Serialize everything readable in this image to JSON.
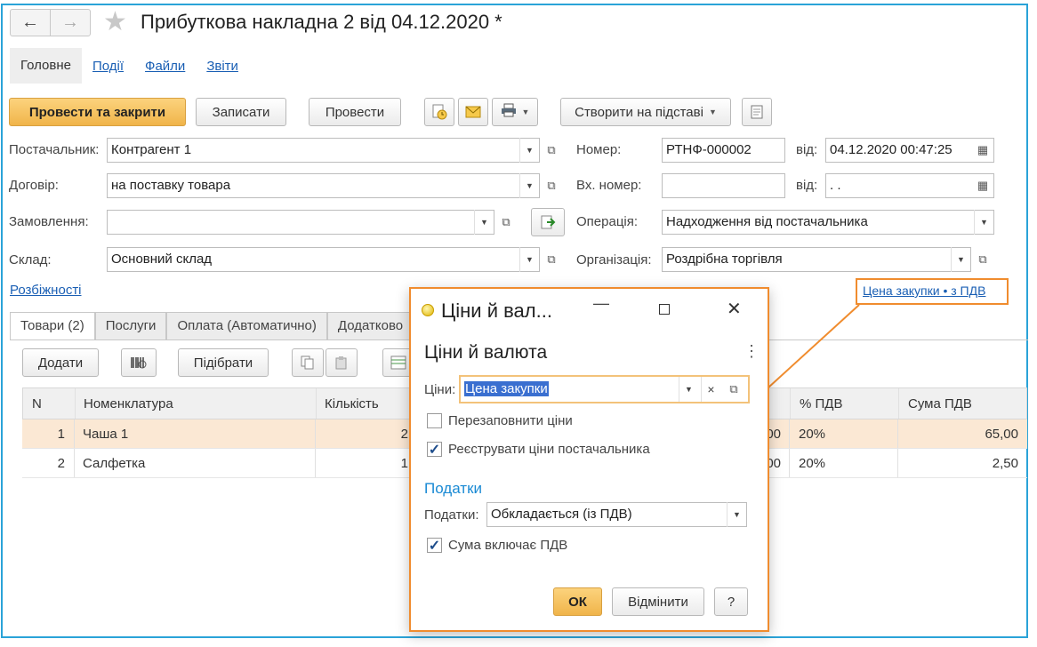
{
  "window": {
    "title": "Прибуткова накладна 2 від 04.12.2020 *",
    "back_glyph": "🡐",
    "forward_glyph": "🡒"
  },
  "top_tabs": [
    {
      "label": "Головне"
    },
    {
      "label": "Події"
    },
    {
      "label": "Файли"
    },
    {
      "label": "Звіти"
    }
  ],
  "toolbar": {
    "post_close": "Провести та закрити",
    "save": "Записати",
    "post": "Провести",
    "create_based": "Створити на підставі"
  },
  "form": {
    "supplier_label": "Постачальник:",
    "supplier_value": "Контрагент 1",
    "contract_label": "Договір:",
    "contract_value": "на поставку товара",
    "order_label": "Замовлення:",
    "order_value": "",
    "warehouse_label": "Склад:",
    "warehouse_value": "Основний склад",
    "number_label": "Номер:",
    "number_value": "РТНФ-000002",
    "date_label": "від:",
    "date_value": "04.12.2020 00:47:25",
    "in_number_label": "Вх. номер:",
    "in_number_value": "",
    "in_date_label": "від:",
    "in_date_value": " .  .",
    "operation_label": "Операція:",
    "operation_value": "Надходження від постачальника",
    "org_label": "Організація:",
    "org_value": "Роздрібна торгівля",
    "discrepancies_link": "Розбіжності",
    "price_link": "Цена закупки • з ПДВ"
  },
  "sub_tabs": [
    {
      "label": "Товари (2)"
    },
    {
      "label": "Послуги"
    },
    {
      "label": "Оплата (Автоматично)"
    },
    {
      "label": "Додатково"
    }
  ],
  "grid_toolbar": {
    "add": "Додати",
    "pick": "Підібрати"
  },
  "grid": {
    "columns": [
      "N",
      "Номенклатура",
      "Кількість",
      "% ПДВ",
      "Сума ПДВ"
    ],
    "rows": [
      {
        "n": "1",
        "item": "Чаша 1",
        "qty": "2",
        "price_tail": "00",
        "vat_pct": "20%",
        "vat_sum": "65,00"
      },
      {
        "n": "2",
        "item": "Салфетка",
        "qty": "1",
        "price_tail": "00",
        "vat_pct": "20%",
        "vat_sum": "2,50"
      }
    ]
  },
  "dialog": {
    "window_title": "Ціни й вал...",
    "heading": "Ціни й валюта",
    "prices_label": "Ціни:",
    "prices_value": "Цена закупки",
    "refill_label": "Перезаповнити ціни",
    "refill_checked": false,
    "register_label": "Реєструвати ціни постачальника",
    "register_checked": true,
    "taxes_section": "Податки",
    "taxes_label": "Податки:",
    "taxes_value": "Обкладається (із ПДВ)",
    "sum_incl_vat_label": "Сума включає ПДВ",
    "sum_incl_vat_checked": true,
    "ok": "ОК",
    "cancel": "Відмінити",
    "help": "?"
  },
  "colors": {
    "accent": "#f0b44a",
    "callout": "#f08c2e",
    "frame": "#2aa3d8",
    "link": "#1a5fb4",
    "selected_row": "#fbe8d4"
  }
}
